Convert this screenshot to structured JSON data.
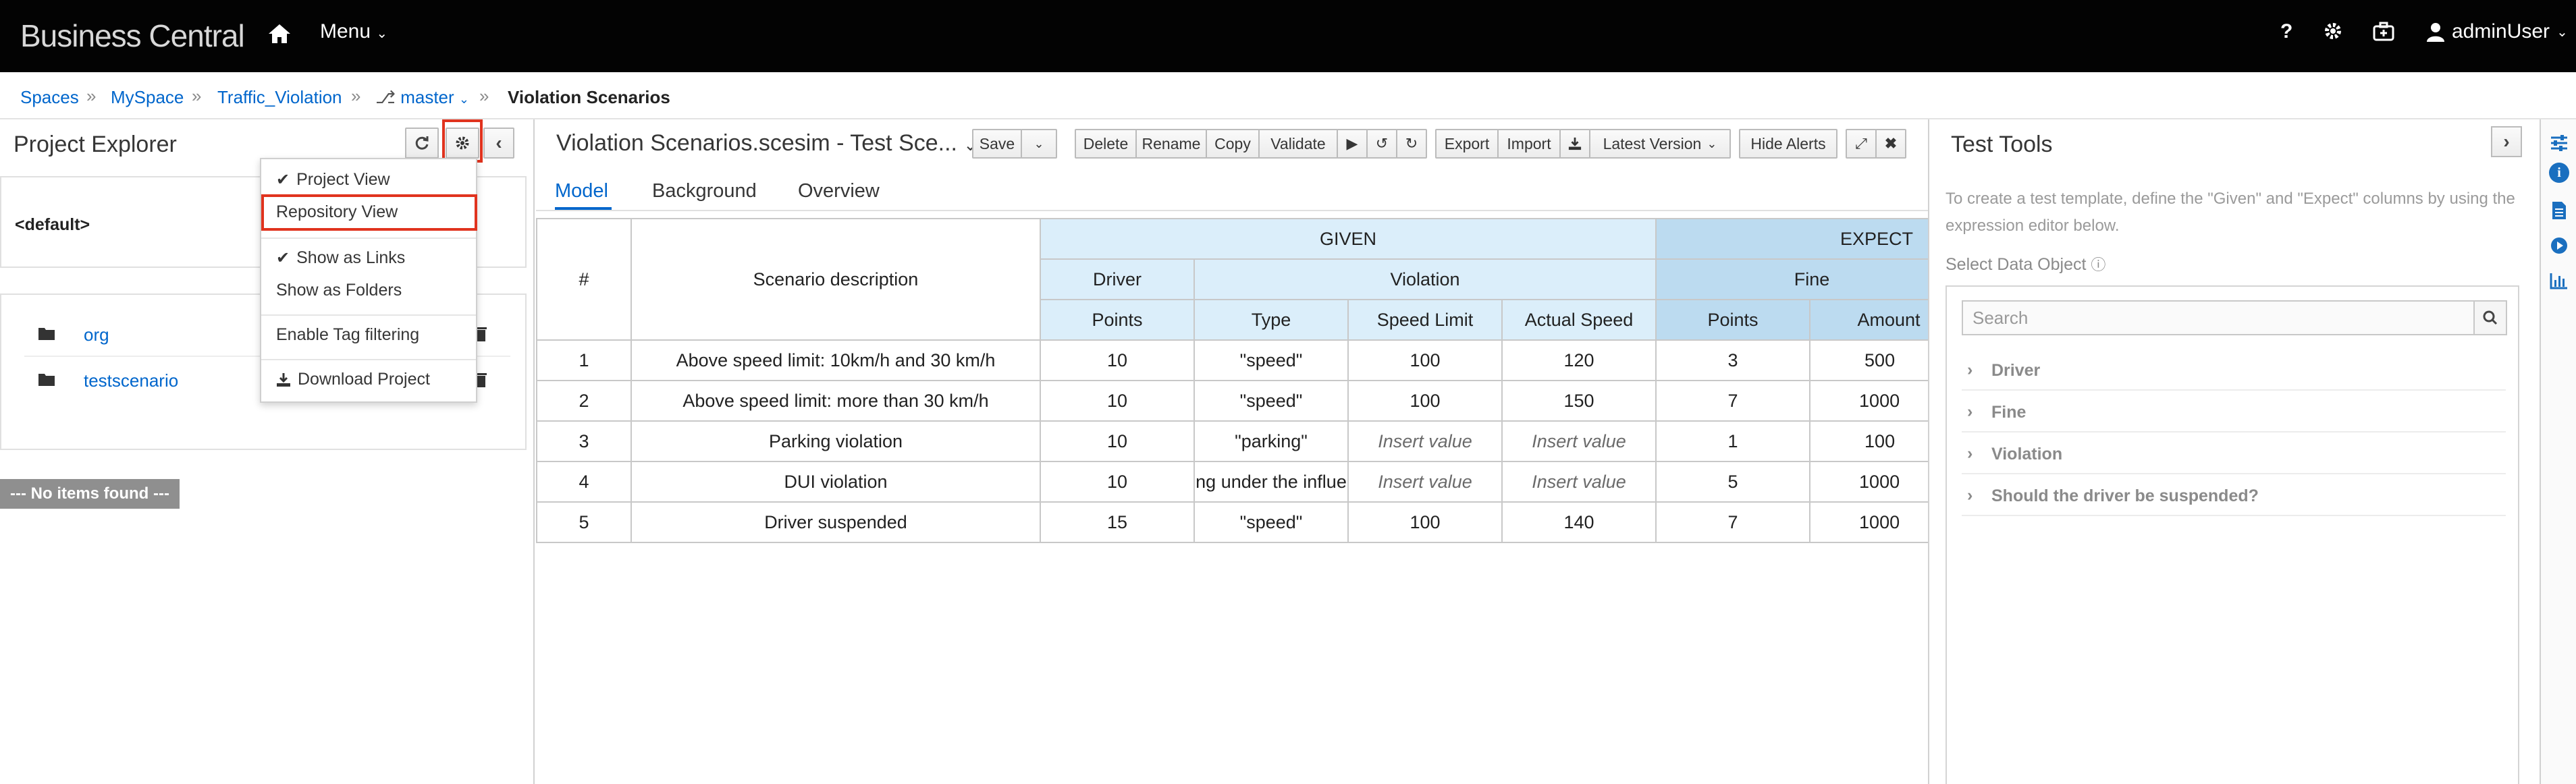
{
  "app": {
    "brand": "Business Central",
    "menu_label": "Menu",
    "help_label": "?",
    "user_label": "adminUser"
  },
  "breadcrumb": {
    "spaces": "Spaces",
    "myspace": "MySpace",
    "project": "Traffic_Violation",
    "branch": "master",
    "current": "Violation Scenarios"
  },
  "explorer": {
    "title": "Project Explorer",
    "default_label": "<default>",
    "folders": [
      {
        "label": "org"
      },
      {
        "label": "testscenario"
      }
    ],
    "no_items": "--- No items found ---"
  },
  "dropdown": {
    "project_view": "Project View",
    "repository_view": "Repository View",
    "show_links": "Show as Links",
    "show_folders": "Show as Folders",
    "tag_filtering": "Enable Tag filtering",
    "download": "Download Project"
  },
  "editor": {
    "title": "Violation Scenarios.scesim - Test Sce...",
    "buttons": {
      "save": "Save",
      "delete": "Delete",
      "rename": "Rename",
      "copy": "Copy",
      "validate": "Validate",
      "export": "Export",
      "import": "Import",
      "latest_version": "Latest Version",
      "hide_alerts": "Hide Alerts"
    },
    "tabs": {
      "model": "Model",
      "background": "Background",
      "overview": "Overview"
    }
  },
  "grid": {
    "headers": {
      "num": "#",
      "desc": "Scenario description",
      "given": "GIVEN",
      "expect": "EXPECT",
      "driver": "Driver",
      "violation": "Violation",
      "fine": "Fine",
      "points": "Points",
      "type": "Type",
      "speed_limit": "Speed Limit",
      "actual_speed": "Actual Speed",
      "fine_points": "Points",
      "amount": "Amount"
    },
    "rows": [
      {
        "n": "1",
        "desc": "Above speed limit: 10km/h and 30 km/h",
        "points": "10",
        "type": "\"speed\"",
        "limit": "100",
        "actual": "120",
        "fpoints": "3",
        "amount": "500"
      },
      {
        "n": "2",
        "desc": "Above speed limit: more than 30 km/h",
        "points": "10",
        "type": "\"speed\"",
        "limit": "100",
        "actual": "150",
        "fpoints": "7",
        "amount": "1000"
      },
      {
        "n": "3",
        "desc": "Parking violation",
        "points": "10",
        "type": "\"parking\"",
        "limit": "Insert value",
        "actual": "Insert value",
        "fpoints": "1",
        "amount": "100"
      },
      {
        "n": "4",
        "desc": "DUI violation",
        "points": "10",
        "type": "ng under the influe",
        "limit": "Insert value",
        "actual": "Insert value",
        "fpoints": "5",
        "amount": "1000"
      },
      {
        "n": "5",
        "desc": "Driver suspended",
        "points": "15",
        "type": "\"speed\"",
        "limit": "100",
        "actual": "140",
        "fpoints": "7",
        "amount": "1000"
      }
    ]
  },
  "tools": {
    "title": "Test Tools",
    "help": "To create a test template, define the \"Given\" and \"Expect\" columns by using the expression editor below.",
    "select_label": "Select Data Object",
    "search_placeholder": "Search",
    "items": [
      {
        "label": "Driver"
      },
      {
        "label": "Fine"
      },
      {
        "label": "Violation"
      },
      {
        "label": "Should the driver be suspended?"
      }
    ]
  },
  "colors": {
    "accent": "#0066cc",
    "highlight": "#e0331e",
    "given": "#dbeefa",
    "expect": "#bcdbf0"
  }
}
